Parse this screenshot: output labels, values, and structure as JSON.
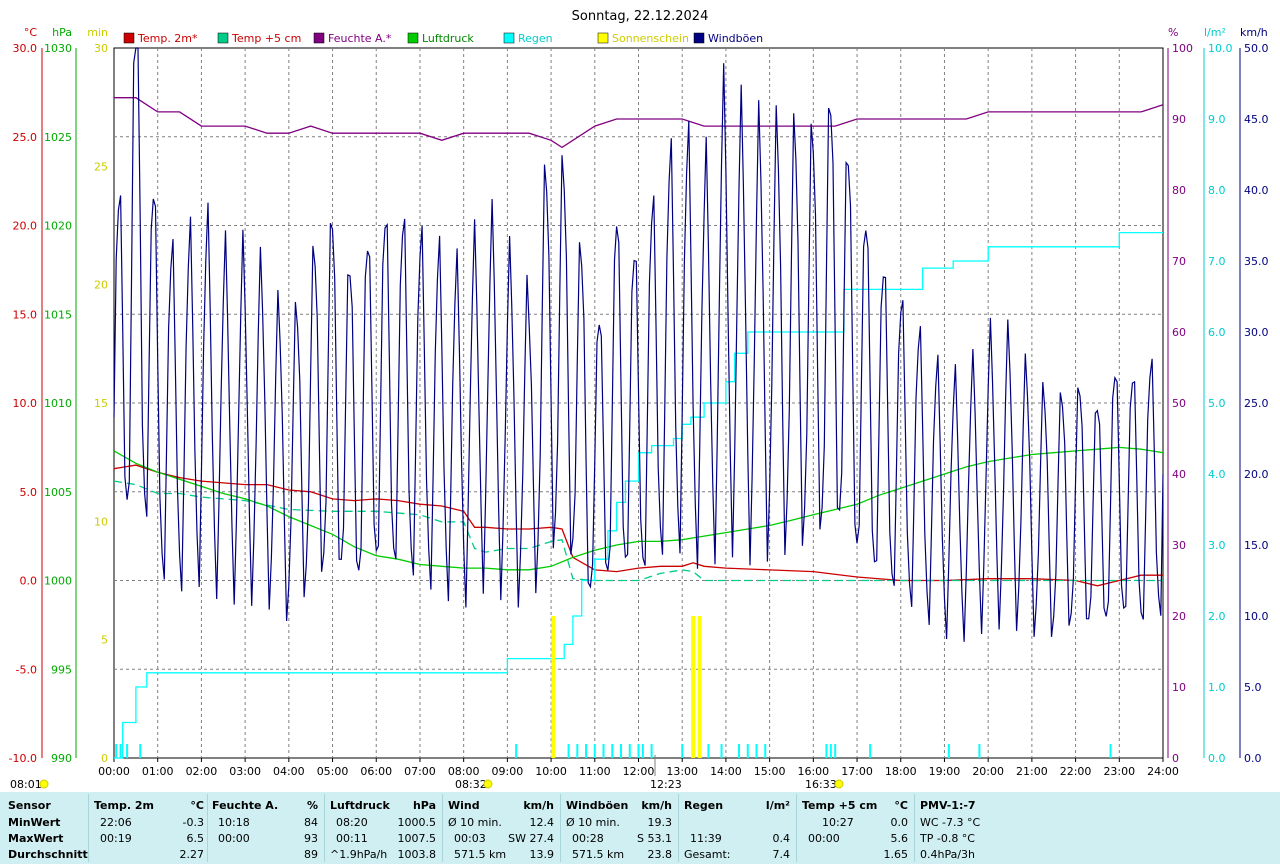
{
  "chart_data": {
    "type": "line",
    "title": "Sonntag, 22.12.2024",
    "x_ticks": [
      "00:00",
      "01:00",
      "02:00",
      "03:00",
      "04:00",
      "05:00",
      "06:00",
      "07:00",
      "08:00",
      "09:00",
      "10:00",
      "11:00",
      "12:00",
      "13:00",
      "14:00",
      "15:00",
      "16:00",
      "17:00",
      "18:00",
      "19:00",
      "20:00",
      "21:00",
      "22:00",
      "23:00",
      "24:00"
    ],
    "x_range_hours": [
      0,
      24
    ],
    "grid": true,
    "axes": {
      "temp": {
        "unit": "°C",
        "min": -10,
        "max": 30,
        "ticks": [
          "30.0",
          "25.0",
          "20.0",
          "15.0",
          "10.0",
          "5.0",
          "0.0",
          "-5.0",
          "-10.0"
        ],
        "color": "#cc0000"
      },
      "pressure": {
        "unit": "hPa",
        "min": 990,
        "max": 1030,
        "ticks": [
          "1030",
          "1025",
          "1020",
          "1015",
          "1010",
          "1005",
          "1000",
          "995",
          "990"
        ],
        "color": "#00aa00"
      },
      "sun_minutes": {
        "unit": "min",
        "min": 0,
        "max": 30,
        "ticks": [
          "30",
          "25",
          "20",
          "15",
          "10",
          "5",
          "0"
        ],
        "color": "#cccc00"
      },
      "humidity": {
        "unit": "%",
        "min": 0,
        "max": 100,
        "ticks": [
          "100",
          "90",
          "80",
          "70",
          "60",
          "50",
          "40",
          "30",
          "20",
          "10",
          "0"
        ],
        "color": "#800080"
      },
      "rain": {
        "unit": "l/m²",
        "min": 0,
        "max": 10,
        "ticks": [
          "10.0",
          "9.0",
          "8.0",
          "7.0",
          "6.0",
          "5.0",
          "4.0",
          "3.0",
          "2.0",
          "1.0",
          "0.0"
        ],
        "color": "#00cccc"
      },
      "wind": {
        "unit": "km/h",
        "min": 0,
        "max": 50,
        "ticks": [
          "50.0",
          "45.0",
          "40.0",
          "35.0",
          "30.0",
          "25.0",
          "20.0",
          "15.0",
          "10.0",
          "5.0",
          "0.0"
        ],
        "color": "#000080"
      }
    },
    "legend": [
      {
        "name": "Temp. 2m*",
        "color": "#cc0000",
        "text_color": "#cc0000"
      },
      {
        "name": "Temp +5 cm",
        "color": "#00cc88",
        "text_color": "#cc0000"
      },
      {
        "name": "Feuchte A.*",
        "color": "#800080",
        "text_color": "#800080"
      },
      {
        "name": "Luftdruck",
        "color": "#00cc00",
        "text_color": "#008800"
      },
      {
        "name": "Regen",
        "color": "#00ffff",
        "text_color": "#00cccc"
      },
      {
        "name": "Sonnenschein",
        "color": "#ffff00",
        "text_color": "#cccc00"
      },
      {
        "name": "Windböen",
        "color": "#000080",
        "text_color": "#000080"
      }
    ],
    "series": [
      {
        "name": "Temp. 2m*",
        "axis": "temp",
        "color": "#cc0000",
        "x": [
          0,
          0.5,
          1,
          1.5,
          2,
          2.5,
          3,
          3.5,
          4,
          4.5,
          5,
          5.5,
          6,
          6.5,
          7,
          7.5,
          8,
          8.25,
          8.5,
          9,
          9.5,
          10,
          10.25,
          10.5,
          11,
          11.5,
          12,
          12.5,
          13,
          13.25,
          13.5,
          14,
          15,
          16,
          17,
          18,
          19,
          20,
          21,
          22,
          22.5,
          23,
          23.5,
          24
        ],
        "y": [
          6.3,
          6.5,
          6.1,
          5.8,
          5.6,
          5.5,
          5.4,
          5.4,
          5.1,
          5.0,
          4.6,
          4.5,
          4.6,
          4.5,
          4.3,
          4.2,
          3.9,
          3.0,
          3.0,
          2.9,
          2.9,
          3.0,
          2.9,
          1.3,
          0.6,
          0.5,
          0.7,
          0.8,
          0.8,
          1.0,
          0.8,
          0.7,
          0.6,
          0.5,
          0.2,
          0.0,
          0.0,
          0.1,
          0.1,
          0.0,
          -0.3,
          0.0,
          0.3,
          0.3
        ]
      },
      {
        "name": "Temp +5 cm",
        "axis": "temp",
        "color": "#00cc88",
        "dash": true,
        "x": [
          0,
          0.5,
          1,
          1.5,
          2,
          3,
          4,
          5,
          6,
          7,
          7.5,
          8,
          8.25,
          8.5,
          9,
          9.5,
          10,
          10.25,
          10.5,
          11,
          11.5,
          12,
          12.5,
          13,
          13.25,
          13.5,
          14,
          15,
          16,
          17,
          18,
          19,
          20,
          21,
          22,
          23,
          24
        ],
        "y": [
          5.6,
          5.4,
          4.9,
          4.9,
          4.7,
          4.5,
          4.0,
          3.9,
          3.9,
          3.7,
          3.3,
          3.3,
          1.8,
          1.6,
          1.8,
          1.8,
          2.2,
          2.3,
          0.1,
          0.0,
          0.0,
          0.0,
          0.4,
          0.6,
          0.5,
          0.0,
          0.0,
          0.0,
          0.0,
          0.0,
          0.0,
          0.0,
          0.0,
          0.0,
          0.0,
          0.0,
          0.0
        ]
      },
      {
        "name": "Feuchte A.*",
        "axis": "humidity",
        "color": "#800080",
        "x": [
          0,
          0.5,
          0.75,
          1,
          1.5,
          2,
          2.5,
          3,
          3.5,
          4,
          4.5,
          5,
          5.5,
          6,
          6.5,
          7,
          7.5,
          8,
          8.5,
          9,
          9.5,
          10,
          10.25,
          10.5,
          11,
          11.5,
          12,
          12.5,
          13,
          13.5,
          14,
          15,
          16,
          16.5,
          17,
          18,
          19,
          19.5,
          20,
          21,
          22,
          23,
          23.5,
          24
        ],
        "y": [
          93,
          93,
          92,
          91,
          91,
          89,
          89,
          89,
          88,
          88,
          89,
          88,
          88,
          88,
          88,
          88,
          87,
          88,
          88,
          88,
          88,
          87,
          86,
          87,
          89,
          90,
          90,
          90,
          90,
          89,
          89,
          89,
          89,
          89,
          90,
          90,
          90,
          90,
          91,
          91,
          91,
          91,
          91,
          92
        ]
      },
      {
        "name": "Luftdruck",
        "axis": "pressure",
        "color": "#00cc00",
        "x": [
          0,
          0.5,
          1,
          1.5,
          2,
          2.5,
          3,
          3.5,
          4,
          4.5,
          5,
          5.5,
          6,
          6.5,
          7,
          7.5,
          8,
          8.5,
          9,
          9.5,
          10,
          10.5,
          11,
          11.5,
          12,
          12.5,
          13,
          13.5,
          14,
          14.5,
          15,
          15.5,
          16,
          16.5,
          17,
          17.5,
          18,
          18.5,
          19,
          19.5,
          20,
          20.5,
          21,
          21.5,
          22,
          22.5,
          23,
          23.5,
          24
        ],
        "y": [
          1007.3,
          1006.6,
          1006.1,
          1005.7,
          1005.3,
          1004.9,
          1004.6,
          1004.2,
          1003.6,
          1003.1,
          1002.6,
          1001.9,
          1001.4,
          1001.2,
          1000.9,
          1000.8,
          1000.7,
          1000.7,
          1000.6,
          1000.6,
          1000.8,
          1001.3,
          1001.7,
          1002.0,
          1002.2,
          1002.2,
          1002.3,
          1002.5,
          1002.7,
          1002.9,
          1003.1,
          1003.4,
          1003.7,
          1004.0,
          1004.3,
          1004.8,
          1005.2,
          1005.6,
          1006.0,
          1006.4,
          1006.7,
          1006.9,
          1007.1,
          1007.2,
          1007.3,
          1007.4,
          1007.5,
          1007.4,
          1007.2
        ]
      },
      {
        "name": "Regen",
        "axis": "rain",
        "color": "#00ffff",
        "step": true,
        "x": [
          0,
          0.2,
          0.5,
          0.75,
          1,
          2,
          3,
          4,
          5,
          6,
          7,
          8,
          8.8,
          9,
          10,
          10.3,
          10.5,
          10.7,
          11,
          11.3,
          11.5,
          11.7,
          12,
          12.3,
          12.5,
          12.8,
          13,
          13.2,
          13.5,
          14,
          14.2,
          14.5,
          15,
          15.5,
          16,
          16.5,
          16.7,
          17,
          18,
          18.5,
          19,
          19.2,
          19.5,
          20,
          21,
          22,
          22.8,
          23,
          24
        ],
        "y": [
          0,
          0.5,
          1.0,
          1.2,
          1.2,
          1.2,
          1.2,
          1.2,
          1.2,
          1.2,
          1.2,
          1.2,
          1.2,
          1.4,
          1.4,
          1.6,
          2.0,
          2.5,
          2.8,
          3.2,
          3.6,
          3.9,
          4.3,
          4.4,
          4.4,
          4.5,
          4.7,
          4.8,
          5.0,
          5.3,
          5.7,
          6.0,
          6.0,
          6.0,
          6.0,
          6.0,
          6.6,
          6.6,
          6.6,
          6.9,
          6.9,
          7.0,
          7.0,
          7.2,
          7.2,
          7.2,
          7.2,
          7.4,
          7.4
        ]
      },
      {
        "name": "Sonnenschein",
        "axis": "sun_minutes",
        "color": "#ffff00",
        "bars": [
          {
            "x": 10.05,
            "v": 6
          },
          {
            "x": 13.25,
            "v": 6
          },
          {
            "x": 13.4,
            "v": 6
          }
        ]
      },
      {
        "name": "Windböen",
        "axis": "wind",
        "color": "#000080",
        "jagged": true,
        "x": [
          0,
          0.5,
          1,
          1.5,
          2,
          2.5,
          3,
          3.5,
          4,
          4.5,
          5,
          5.5,
          6,
          6.5,
          7,
          7.5,
          8,
          8.5,
          9,
          9.5,
          10,
          10.5,
          11,
          11.5,
          12,
          12.5,
          13,
          13.5,
          14,
          14.5,
          15,
          15.5,
          16,
          16.5,
          17,
          17.5,
          18,
          18.5,
          19,
          19.5,
          20,
          20.5,
          21,
          21.5,
          22,
          22.5,
          23,
          23.5,
          24
        ],
        "y": [
          24,
          38,
          25,
          24,
          26,
          24,
          24,
          23,
          20,
          24,
          26,
          23,
          26,
          26,
          25,
          24,
          23,
          26,
          24,
          22,
          30,
          27,
          20,
          26,
          24,
          28,
          30,
          28,
          32,
          30,
          30,
          30,
          30,
          32,
          27,
          24,
          22,
          20,
          18,
          18,
          20,
          20,
          18,
          17,
          18,
          17,
          19,
          18,
          20
        ]
      }
    ],
    "annotations": {
      "sunrise": "08:01",
      "sunset": "16:33",
      "rain_start": "08:32",
      "noon": "12:23"
    }
  },
  "footer": {
    "sensor": {
      "hdr": "Sensor",
      "min": "MinWert",
      "max": "MaxWert",
      "avg": "Durchschnitt"
    },
    "temp2m": {
      "hdr": "Temp. 2m",
      "unit": "°C",
      "min_t": "22:06",
      "min_v": "-0.3",
      "max_t": "00:19",
      "max_v": "6.5",
      "avg_v": "2.27"
    },
    "humidity": {
      "hdr": "Feuchte A.",
      "unit": "%",
      "min_t": "10:18",
      "min_v": "84",
      "max_t": "00:00",
      "max_v": "93",
      "avg_v": "89"
    },
    "pressure": {
      "hdr": "Luftdruck",
      "unit": "hPa",
      "min_t": "08:20",
      "min_v": "1000.5",
      "max_t": "00:11",
      "max_v": "1007.5",
      "avg_t": "^1.9hPa/h",
      "avg_v": "1003.8"
    },
    "wind": {
      "hdr": "Wind",
      "unit": "km/h",
      "min_t": "Ø 10 min.",
      "min_v": "12.4",
      "max_t": "00:03",
      "max_v": "SW 27.4",
      "avg_t": "571.5 km",
      "avg_v": "13.9"
    },
    "gusts": {
      "hdr": "Windböen",
      "unit": "km/h",
      "min_t": "Ø 10 min.",
      "min_v": "19.3",
      "max_t": "00:28",
      "max_v": "S 53.1",
      "avg_t": "571.5 km",
      "avg_v": "23.8"
    },
    "rain": {
      "hdr": "Regen",
      "unit": "l/m²",
      "max_t": "11:39",
      "max_v": "0.4",
      "avg_t": "Gesamt:",
      "avg_v": "7.4"
    },
    "temp5": {
      "hdr": "Temp +5 cm",
      "unit": "°C",
      "min_t": "10:27",
      "min_v": "0.0",
      "max_t": "00:00",
      "max_v": "5.6",
      "avg_v": "1.65"
    },
    "pmv": {
      "hdr": "PMV-1:-7",
      "min_t": "WC -7.3 °C",
      "max_t": "TP -0.8 °C",
      "avg_t": "0.4hPa/3h"
    }
  }
}
